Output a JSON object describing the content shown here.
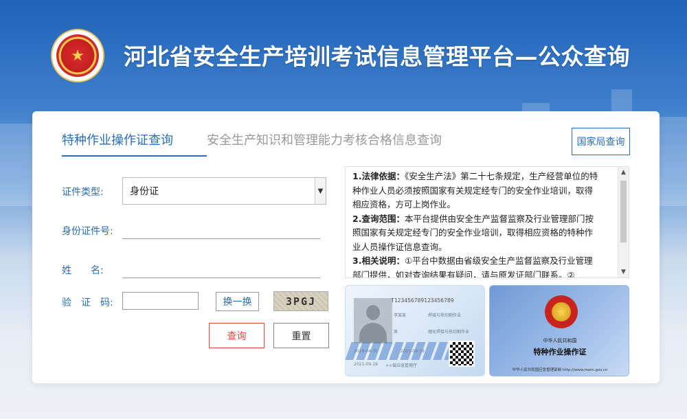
{
  "header": {
    "title": "河北省安全生产培训考试信息管理平台—公众查询",
    "emblem_text": "河北省安全生产培训考试信息管理平台"
  },
  "tabs": [
    {
      "label": "特种作业操作证查询",
      "active": true
    },
    {
      "label": "安全生产知识和管理能力考核合格信息查询",
      "active": false
    }
  ],
  "national_button": "国家局查询",
  "form": {
    "cert_type_label": "证件类型:",
    "cert_type_value": "身份证",
    "cert_no_label": "身份证件号:",
    "name_label": "姓　　名:",
    "captcha_label": "验　证　码:",
    "swap_label": "换一换",
    "captcha_code": "3PGJ",
    "query_label": "查询",
    "reset_label": "重置"
  },
  "notice": {
    "p1_title": "1.法律依据：",
    "p1_text": "《安全生产法》第二十七条规定，生产经营单位的特种作业人员必须按照国家有关规定经专门的安全作业培训，取得相应资格，方可上岗作业。",
    "p2_title": "2.查询范围：",
    "p2_text": "本平台提供由安全生产监督监察及行业管理部门按照国家有关规定经专门的安全作业培训，取得相应资格的特种作业人员操作证信息查询。",
    "p3_title": "3.相关说明：",
    "p3_text": "①平台中数据由省级安全生产监督监察及行业管理部门提供，如对查询结果有疑问，请与原发证部门联系。②"
  },
  "card_front": {
    "id_number": "T123456789123456789",
    "name": "李某某",
    "category": "焊接与热切割作业",
    "sex": "男",
    "job": "熔化焊接与热切割作业",
    "date1": "2018-04-30",
    "date2": "2021-09-19",
    "authority": "××省应急管理厅"
  },
  "card_back": {
    "country": "中华人民共和国",
    "title": "特种作业操作证",
    "footer": "中华人民共和国应急管理部制  http://www.mem.gov.cn"
  },
  "colors": {
    "primary": "#2a6db5",
    "danger": "#d84b3a",
    "header_bg": "#1f62b8"
  }
}
